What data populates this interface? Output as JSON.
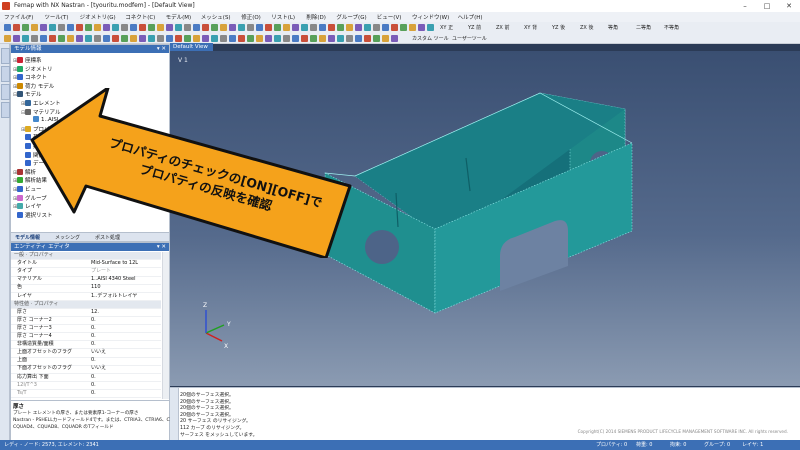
{
  "window": {
    "title": "Femap with NX Nastran - [tyouritu.modfem] - [Default View]",
    "minimize": "–",
    "maximize": "□",
    "close": "✕"
  },
  "menu": [
    "ファイル(F)",
    "ツール(T)",
    "ジオメトリ(G)",
    "コネクト(C)",
    "モデル(M)",
    "メッシュ(S)",
    "修正(O)",
    "リスト(L)",
    "削除(D)",
    "グループ(G)",
    "ビュー(V)",
    "ウィンドウ(W)",
    "ヘルプ(H)"
  ],
  "toolbar_right": [
    "XY 正",
    "YZ 前",
    "ZX 前",
    "XY 背",
    "YZ 後",
    "ZX 後",
    "等角",
    "二等角",
    "不等角"
  ],
  "toolbar2_labels": [
    "カスタム ツール",
    "ユーザーツール"
  ],
  "model_panel": {
    "title": "モデル情報",
    "tree": [
      {
        "label": "座標系",
        "indent": 1,
        "exp": "⊞",
        "icon": "#c23"
      },
      {
        "label": "ジオメトリ",
        "indent": 1,
        "exp": "⊞",
        "icon": "#2a6"
      },
      {
        "label": "コネクト",
        "indent": 1,
        "exp": "⊞",
        "icon": "#36c"
      },
      {
        "label": "荷力 モデル",
        "indent": 1,
        "exp": "⊞",
        "icon": "#c80"
      },
      {
        "label": "モデル",
        "indent": 1,
        "exp": "⊟",
        "icon": "#357"
      },
      {
        "label": "エレメント",
        "indent": 2,
        "exp": "⊞",
        "icon": "#369"
      },
      {
        "label": "マテリアル",
        "indent": 2,
        "exp": "⊟",
        "icon": "#666"
      },
      {
        "label": "1..AISI",
        "indent": 3,
        "exp": "",
        "icon": "#48c"
      },
      {
        "label": "プロパティ",
        "indent": 2,
        "exp": "⊞",
        "icon": "#da2"
      },
      {
        "label": "荷重",
        "indent": 2,
        "exp": "",
        "icon": "#36c"
      },
      {
        "label": "拘束",
        "indent": 2,
        "exp": "",
        "icon": "#36c"
      },
      {
        "label": "関数",
        "indent": 2,
        "exp": "",
        "icon": "#36c"
      },
      {
        "label": "データ…",
        "indent": 2,
        "exp": "",
        "icon": "#36c"
      },
      {
        "label": "解析",
        "indent": 1,
        "exp": "⊞",
        "icon": "#a33"
      },
      {
        "label": "解析結果",
        "indent": 1,
        "exp": "⊞",
        "icon": "#3a3"
      },
      {
        "label": "ビュー",
        "indent": 1,
        "exp": "⊞",
        "icon": "#36c"
      },
      {
        "label": "グループ",
        "indent": 1,
        "exp": "⊞",
        "icon": "#c6c"
      },
      {
        "label": "レイヤ",
        "indent": 1,
        "exp": "⊞",
        "icon": "#4aa"
      },
      {
        "label": "選択リスト",
        "indent": 1,
        "exp": "",
        "icon": "#36c"
      }
    ],
    "tabs": [
      "モデル情報",
      "メッシング",
      "ポスト処理"
    ]
  },
  "entity_editor": {
    "title": "エンティティ エディタ",
    "rows": [
      {
        "k": "一般 · プロパティ",
        "v": "",
        "type": "sec"
      },
      {
        "k": "タイトル",
        "v": "Mid-Surface to 12L",
        "type": ""
      },
      {
        "k": "タイプ",
        "v": "プレート",
        "type": "grey"
      },
      {
        "k": "マテリアル",
        "v": "1..AISI 4340 Steel",
        "type": ""
      },
      {
        "k": "色",
        "v": "110",
        "type": ""
      },
      {
        "k": "レイヤ",
        "v": "1..デフォルトレイヤ",
        "type": ""
      },
      {
        "k": "特性値 · プロパティ",
        "v": "",
        "type": "sec"
      },
      {
        "k": "厚さ",
        "v": "12.",
        "type": ""
      },
      {
        "k": "厚さ コーナー2",
        "v": "0.",
        "type": ""
      },
      {
        "k": "厚さ コーナー3",
        "v": "0.",
        "type": ""
      },
      {
        "k": "厚さ コーナー4",
        "v": "0.",
        "type": ""
      },
      {
        "k": "非構造質量/面積",
        "v": "0.",
        "type": ""
      },
      {
        "k": "上面オフセットのフラグ",
        "v": "いいえ",
        "type": ""
      },
      {
        "k": "上面",
        "v": "0.",
        "type": ""
      },
      {
        "k": "下面オフセットのフラグ",
        "v": "いいえ",
        "type": ""
      },
      {
        "k": "応力算出 下面",
        "v": "0.",
        "type": ""
      },
      {
        "k": "12I/T^3",
        "v": "0.",
        "type": "gk"
      },
      {
        "k": "Ts/T",
        "v": "0.",
        "type": "gk"
      }
    ]
  },
  "description": {
    "title": "厚さ",
    "lines": [
      "プレート エレメントの厚さ、または要素厚1-コーナーの厚さ",
      "Nastran - PSHELLカードフィールド4です。または、CTRIA3、CTRIA6、CTRIAR、",
      "CQUAD4、CQUAD8、CQUADR のTフィールド"
    ]
  },
  "viewport": {
    "tab": "Default View",
    "label": "V 1",
    "axes": {
      "x": "X",
      "y": "Y",
      "z": "Z"
    }
  },
  "callout": {
    "line1": "プロパティのチェックの[ON][OFF]で",
    "line2": "プロパティの反映を確認"
  },
  "messages": {
    "lines": [
      "20個のサーフェス選択。",
      "20個のサーフェス選択。",
      "20個のサーフェス選択。",
      "20個のサーフェス選択。",
      "20 サーフェス のリサイジング。",
      "112 カーブ のリサイジング。",
      "サーフェス をメッシュしています。"
    ],
    "copyright": "Copyright(C) 2014 SIEMENS PRODUCT LIFECYCLE MANAGEMENT SOFTWARE INC. All rights reserved."
  },
  "status": {
    "left": "レディ - ノード: 2573, エレメント: 2341",
    "right": [
      "プロパティ: 0",
      "荷重: 0",
      "拘束: 0",
      "グループ: 0",
      "レイヤ: 1"
    ]
  },
  "colors": {
    "part": "#1f8a8a",
    "callout": "#f5a21b",
    "header": "#3c6fb5"
  }
}
